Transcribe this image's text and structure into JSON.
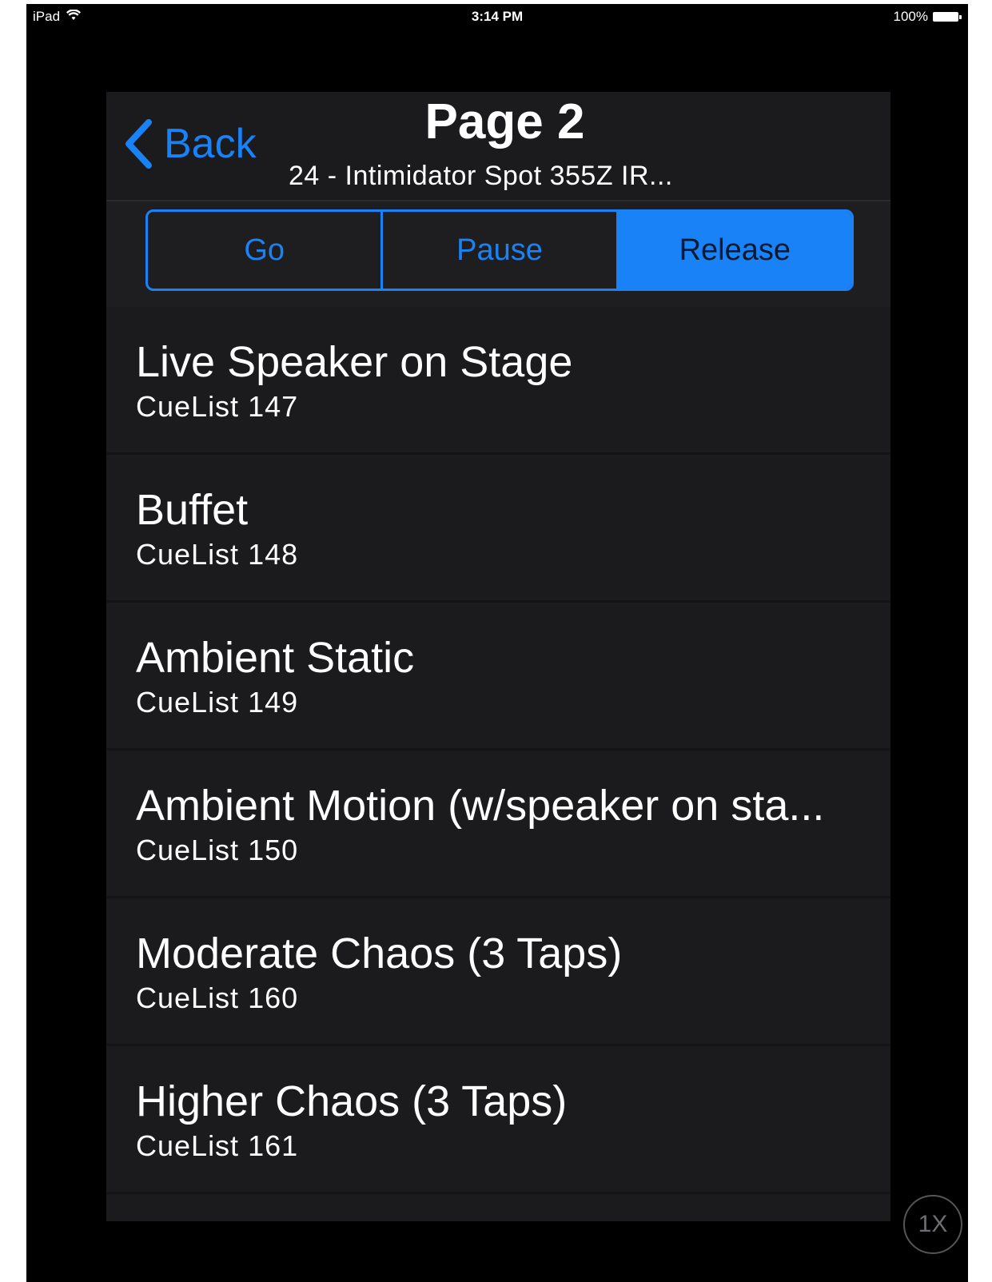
{
  "status_bar": {
    "device": "iPad",
    "time": "3:14 PM",
    "battery": "100%"
  },
  "nav": {
    "back_label": "Back",
    "title": "Page 2",
    "subtitle": "24 - Intimidator Spot 355Z IR..."
  },
  "segments": [
    {
      "label": "Go",
      "active": false
    },
    {
      "label": "Pause",
      "active": false
    },
    {
      "label": "Release",
      "active": true
    }
  ],
  "cuelists": [
    {
      "name": "Live Speaker on Stage",
      "sub": "CueList 147"
    },
    {
      "name": "Buffet",
      "sub": "CueList 148"
    },
    {
      "name": "Ambient Static",
      "sub": "CueList 149"
    },
    {
      "name": "Ambient Motion (w/speaker on sta...",
      "sub": "CueList 150"
    },
    {
      "name": "Moderate Chaos (3 Taps)",
      "sub": "CueList 160"
    },
    {
      "name": "Higher Chaos (3 Taps)",
      "sub": "CueList 161"
    }
  ],
  "speed_button": "1X",
  "colors": {
    "accent": "#1a82f7",
    "panel": "#1b1b1d",
    "background": "#000000"
  }
}
